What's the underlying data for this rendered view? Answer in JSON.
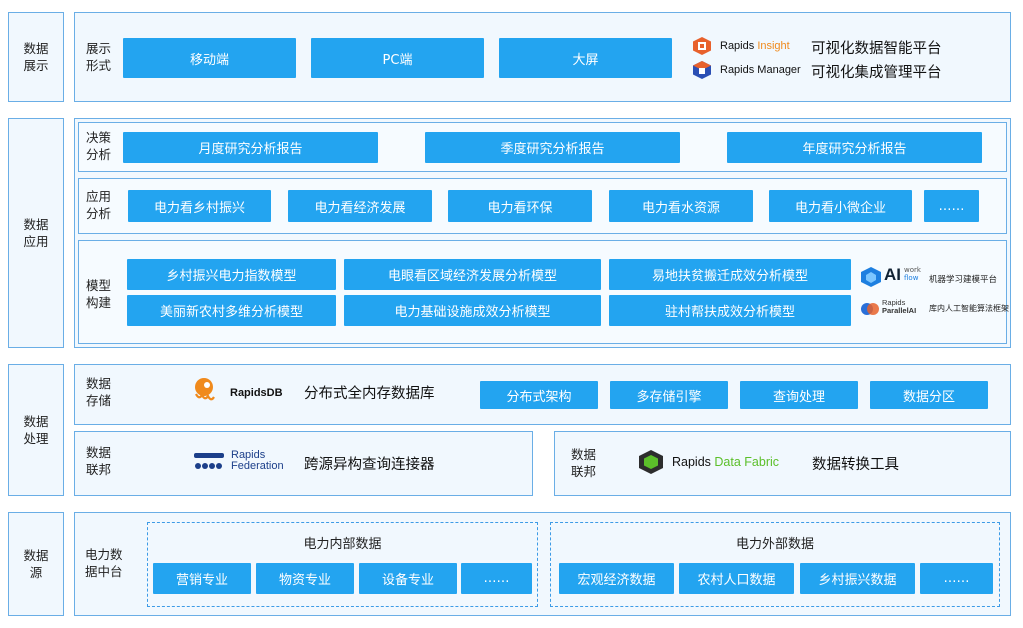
{
  "layers": {
    "display": "数据\n展示",
    "application": "数据\n应用",
    "processing": "数据\n处理",
    "source": "数据\n源"
  },
  "display_row": {
    "label": "展示\n形式",
    "buttons": [
      "移动端",
      "PC端",
      "大屏"
    ],
    "insight": {
      "prefix": "Rapids",
      "accent": "Insight",
      "name": "可视化数据智能平台"
    },
    "manager": {
      "prefix": "Rapids Manager",
      "name": "可视化集成管理平台"
    }
  },
  "decision_row": {
    "label": "决策\n分析",
    "buttons": [
      "月度研究分析报告",
      "季度研究分析报告",
      "年度研究分析报告"
    ]
  },
  "analysis_row": {
    "label": "应用\n分析",
    "buttons": [
      "电力看乡村振兴",
      "电力看经济发展",
      "电力看环保",
      "电力看水资源",
      "电力看小微企业",
      "……"
    ]
  },
  "model_row": {
    "label": "模型\n构建",
    "buttons": [
      "乡村振兴电力指数模型",
      "电眼看区域经济发展分析模型",
      "易地扶贫搬迁成效分析模型",
      "美丽新农村多维分析模型",
      "电力基础设施成效分析模型",
      "驻村帮扶成效分析模型"
    ],
    "aiflow": {
      "logo": "AI",
      "work": "work",
      "flow": "flow",
      "caption": "机器学习建模平台"
    },
    "parallel": {
      "line1": "Rapids",
      "line2": "ParallelAI",
      "caption": "库内人工智能算法框架"
    }
  },
  "storage_row": {
    "label": "数据\n存储",
    "logo": "RapidsDB",
    "name": "分布式全内存数据库",
    "buttons": [
      "分布式架构",
      "多存储引擎",
      "查询处理",
      "数据分区"
    ]
  },
  "federation_row": {
    "label": "数据\n联邦",
    "logo_line1": "Rapids",
    "logo_line2": "Federation",
    "name": "跨源异构查询连接器"
  },
  "fabric_row": {
    "label": "数据\n联邦",
    "prefix": "Rapids",
    "accent": "Data Fabric",
    "name": "数据转换工具"
  },
  "source_row": {
    "label": "电力数\n据中台",
    "internal": {
      "title": "电力内部数据",
      "buttons": [
        "营销专业",
        "物资专业",
        "设备专业",
        "……"
      ]
    },
    "external": {
      "title": "电力外部数据",
      "buttons": [
        "宏观经济数据",
        "农村人口数据",
        "乡村振兴数据",
        "……"
      ]
    }
  },
  "colors": {
    "button": "#23a4f0",
    "border": "#6aaee6",
    "accent_orange": "#f08a1c",
    "accent_green": "#5cbf2a"
  }
}
